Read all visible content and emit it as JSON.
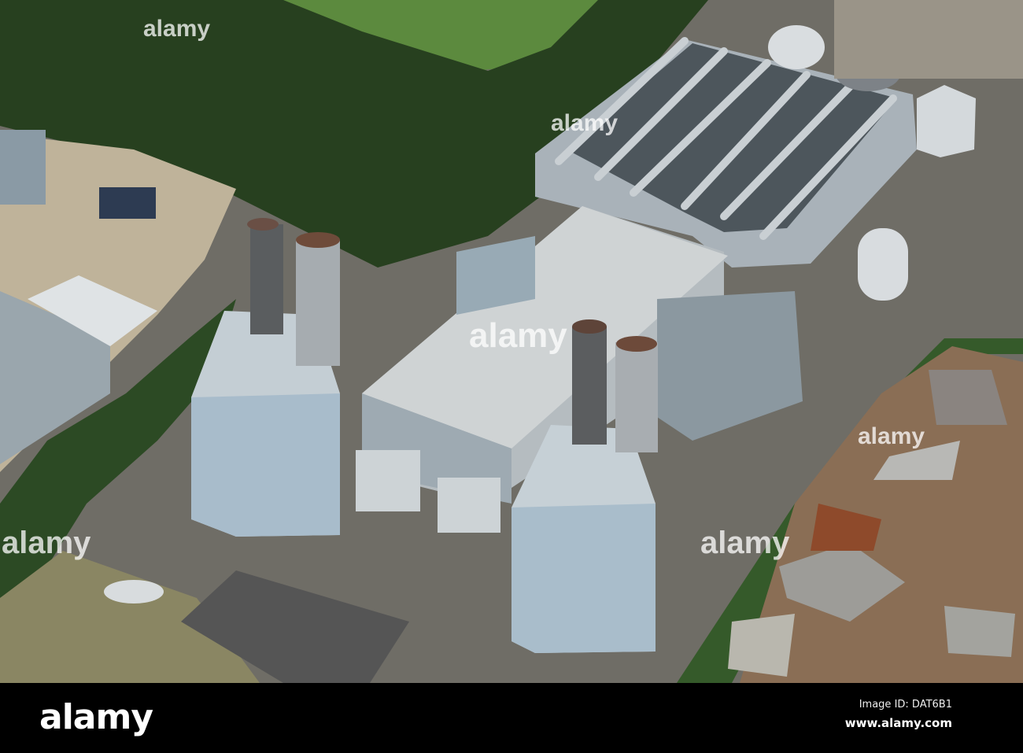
{
  "photo": {
    "subject": "Aerial view of gas-fired power station",
    "watermark": "alamy"
  },
  "footer": {
    "logo": "alamy",
    "image_id": "Image ID: DAT6B1",
    "url": "www.alamy.com"
  }
}
